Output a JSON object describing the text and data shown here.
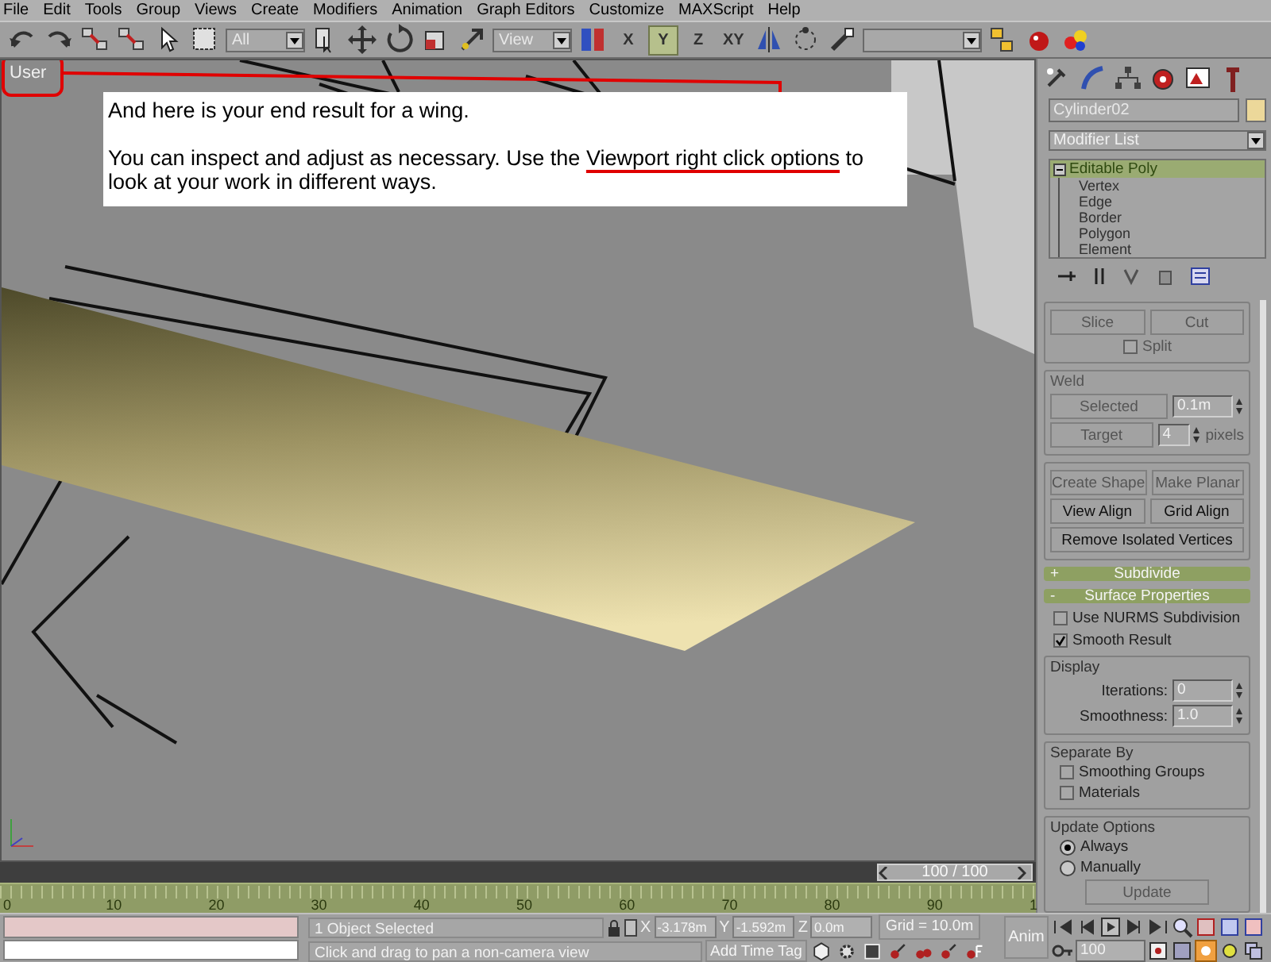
{
  "menu": [
    "File",
    "Edit",
    "Tools",
    "Group",
    "Views",
    "Create",
    "Modifiers",
    "Animation",
    "Graph Editors",
    "Customize",
    "MAXScript",
    "Help"
  ],
  "toolbar": {
    "selection_filter": "All",
    "reference_coord": "View",
    "axis_constraints": [
      {
        "label": "X",
        "selected": false
      },
      {
        "label": "Y",
        "selected": true
      },
      {
        "label": "Z",
        "selected": false
      },
      {
        "label": "XY",
        "selected": false
      }
    ]
  },
  "viewport": {
    "label": "User",
    "note": {
      "title": "And here is your end result for a wing.",
      "parts": [
        {
          "text": "You can inspect and adjust as necessary.  Use the ",
          "underlined": false
        },
        {
          "text": "Viewport right click options",
          "underlined": true
        },
        {
          "text": " to look at your work in different ways.",
          "underlined": false
        }
      ]
    }
  },
  "command_panel": {
    "object_name": "Cylinder02",
    "modifier_list": "Modifier List",
    "stack": [
      {
        "label": "Editable Poly",
        "selected": true,
        "children": [
          {
            "label": "Vertex"
          },
          {
            "label": "Edge"
          },
          {
            "label": "Border"
          },
          {
            "label": "Polygon"
          },
          {
            "label": "Element"
          }
        ]
      }
    ],
    "edit_geometry": {
      "slice_buttons": [
        {
          "label": "Slice",
          "disabled": true
        },
        {
          "label": "Cut",
          "disabled": true
        }
      ],
      "split": {
        "label": "Split",
        "checked": false,
        "disabled": true
      },
      "weld": {
        "title": "Weld",
        "disabled": true,
        "selected": {
          "label": "Selected",
          "value": "0.1m"
        },
        "target": {
          "label": "Target",
          "value": "4",
          "unit": "pixels"
        }
      },
      "button_rows": [
        [
          {
            "label": "Create Shape",
            "disabled": true
          },
          {
            "label": "Make Planar",
            "disabled": true
          }
        ],
        [
          {
            "label": "View Align",
            "disabled": false
          },
          {
            "label": "Grid Align",
            "disabled": false
          }
        ],
        [
          {
            "label": "Remove Isolated Vertices",
            "disabled": false
          }
        ]
      ]
    },
    "rollouts": [
      {
        "sign": "+",
        "title": "Subdivide"
      },
      {
        "sign": "-",
        "title": "Surface Properties"
      }
    ],
    "surface_properties": {
      "checks": [
        {
          "label": "Use NURMS Subdivision",
          "checked": false
        },
        {
          "label": "Smooth Result",
          "checked": true
        }
      ],
      "display": {
        "title": "Display",
        "fields": [
          {
            "label": "Iterations:",
            "value": "0"
          },
          {
            "label": "Smoothness:",
            "value": "1.0"
          }
        ]
      },
      "separate_by": {
        "title": "Separate By",
        "checks": [
          {
            "label": "Smoothing Groups",
            "checked": false
          },
          {
            "label": "Materials",
            "checked": false
          }
        ]
      },
      "update_options": {
        "title": "Update Options",
        "radios": [
          {
            "label": "Always",
            "selected": true
          },
          {
            "label": "Manually",
            "selected": false
          }
        ],
        "button": {
          "label": "Update",
          "disabled": true
        }
      }
    }
  },
  "time_slider": {
    "label": "100 / 100",
    "level": 1
  },
  "trackbar": {
    "ticks": [
      "0",
      "10",
      "20",
      "30",
      "40",
      "50",
      "60",
      "70",
      "80",
      "90",
      "1"
    ]
  },
  "status": {
    "selection": "1 Object Selected",
    "prompt": "Click and drag to pan a non-camera view",
    "coords": [
      {
        "axis": "X",
        "value": "-3.178m"
      },
      {
        "axis": "Y",
        "value": "-1.592m"
      },
      {
        "axis": "Z",
        "value": "0.0m"
      }
    ],
    "grid": "Grid = 10.0m",
    "add_time_tag": "Add Time Tag",
    "anim": "Anim",
    "frame": "100"
  }
}
